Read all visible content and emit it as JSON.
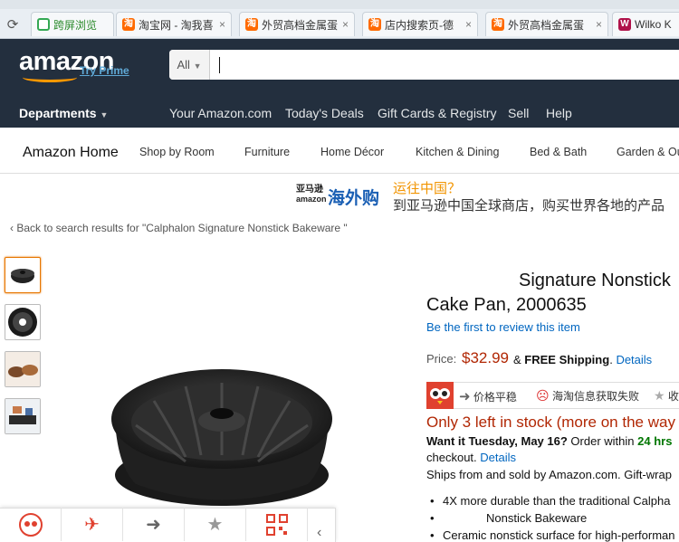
{
  "browser": {
    "tabs": [
      {
        "label": "跨屏浏览",
        "icon": "cross-screen-icon"
      },
      {
        "label": "淘宝网 - 淘我喜",
        "icon": "taobao-icon"
      },
      {
        "label": "外贸高档金属蛋",
        "icon": "taobao-icon"
      },
      {
        "label": "店内搜索页-德",
        "icon": "taobao-icon"
      },
      {
        "label": "外贸高档金属蛋",
        "icon": "taobao-icon"
      },
      {
        "label": "Wilko K",
        "icon": "wilko-icon"
      }
    ],
    "close_glyph": "×"
  },
  "header": {
    "logo_text": "amazon",
    "try_prime": "Try Prime",
    "search_category": "All",
    "departments": "Departments",
    "links": [
      "Your Amazon.com",
      "Today's Deals",
      "Gift Cards & Registry",
      "Sell",
      "Help"
    ]
  },
  "subnav": {
    "home": "Amazon Home",
    "items": [
      "Shop by Room",
      "Furniture",
      "Home Décor",
      "Kitchen & Dining",
      "Bed & Bath",
      "Garden & Ou"
    ]
  },
  "banner": {
    "brand_top": "亚马逊",
    "brand_bottom": "amazon",
    "headline": "海外购",
    "question": "运往中国？",
    "subtitle": "到亚马逊中国全球商店，购买世界各地的产品"
  },
  "breadcrumb": "‹ Back to search results for \"Calphalon Signature Nonstick Bakeware \"",
  "product": {
    "title_line1": "Signature Nonstick",
    "title_line2": "Cake Pan, 2000635",
    "review_link": "Be the first to review this item",
    "price_label": "Price:",
    "price": "$32.99",
    "shipping_prefix": "&",
    "shipping_bold": "FREE Shipping",
    "shipping_details": "Details",
    "stock": "Only 3 left in stock (more on the way",
    "want_prefix": "Want it Tuesday, May 16?",
    "want_order": "Order within",
    "want_time": "24 hrs",
    "checkout": "checkout.",
    "checkout_details": "Details",
    "sold_by": "Ships from and sold by Amazon.com. Gift-wrap",
    "bullets": [
      "4X more durable than the traditional Calpha",
      "Nonstick Bakeware",
      "Ceramic nonstick surface for high-performan"
    ]
  },
  "extension_bar": {
    "price_compare": "价格平稳",
    "haitao_fail": "海淘信息获取失败",
    "collect": "收"
  },
  "bottom_toolbar": {
    "icons": [
      "owl-icon",
      "plane-icon",
      "arrow-right-icon",
      "star-icon",
      "qr-code-icon"
    ],
    "collapse": "‹"
  },
  "colors": {
    "amazon_nav": "#232f3e",
    "prime_blue": "#5fa9d6",
    "price_red": "#b12704",
    "link_blue": "#0066c0",
    "stock_green": "#007600",
    "accent_orange": "#f90"
  }
}
